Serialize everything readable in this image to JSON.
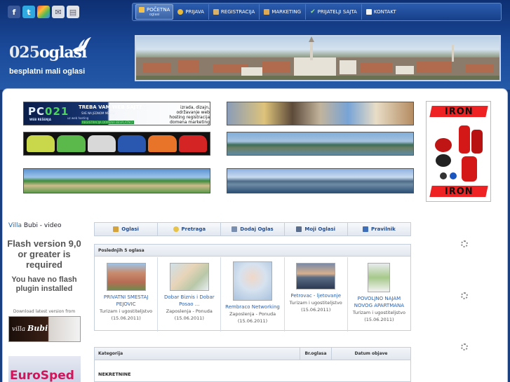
{
  "social": [
    {
      "name": "facebook-icon",
      "glyph": "f"
    },
    {
      "name": "twitter-icon",
      "glyph": "t"
    },
    {
      "name": "delicious-icon",
      "glyph": ""
    },
    {
      "name": "mail-icon",
      "glyph": "✉"
    },
    {
      "name": "print-icon",
      "glyph": "▤"
    }
  ],
  "nav": {
    "items": [
      {
        "label": "POČETNA",
        "sub": "oglasi",
        "icon": "home-icon"
      },
      {
        "label": "PRIJAVA",
        "icon": "key-icon"
      },
      {
        "label": "REGISTRACIJA",
        "icon": "folder-icon"
      },
      {
        "label": "MARKETING",
        "icon": "briefcase-icon"
      },
      {
        "label": "PRIJATELJI SAJTA",
        "icon": "check-icon"
      },
      {
        "label": "KONTAKT",
        "icon": "envelope-icon"
      }
    ]
  },
  "logo": {
    "number": "025",
    "name": "oglasi",
    "tagline": "besplatni mali oglasi"
  },
  "banner_pc021": {
    "brand_pre": "PC",
    "brand_num": "021",
    "sub": "WEB REŠENJA",
    "headline": "TREBA VAM WEB SAJT?",
    "line2": "SVE NA JEDNOM MESTU",
    "line3": "uz web hosting",
    "line4": "REGISTRACIJA DOMENA BESPLATNO!",
    "right": "izrada, dizajn, održavanje web hosting registracija domena marketing"
  },
  "iron": {
    "word": "IRON"
  },
  "sidebar": {
    "villa_a": "Villa",
    "villa_b": "Bubi - video",
    "flash_msg": "Flash version 9,0 or greater is required",
    "flash_missing": "You have no flash plugin installed",
    "download": "Download latest version from",
    "villa_banner_a": "villa",
    "villa_banner_b": "Bubi",
    "euro": "EuroSped"
  },
  "tabs": [
    {
      "label": "Oglasi",
      "icon": "home-icon"
    },
    {
      "label": "Pretraga",
      "icon": "search-icon"
    },
    {
      "label": "Dodaj Oglas",
      "icon": "add-listing-icon"
    },
    {
      "label": "Moji Oglasi",
      "icon": "my-listings-icon"
    },
    {
      "label": "Pravilnik",
      "icon": "book-icon"
    }
  ],
  "latest": {
    "header": "Poslednjih 5 oglasa",
    "items": [
      {
        "title": "PRIVATNI SMESTAJ PEJOVIC",
        "category": "Turizam i ugostiteljstvo",
        "date": "(15.06.2011)"
      },
      {
        "title": "Dobar Biznis i Dobar Posao ...",
        "category": "Zaposlenja - Ponuda",
        "date": "(15.06.2011)"
      },
      {
        "title": "Rembraco Networking",
        "category": "Zaposlenja - Ponuda",
        "date": "(15.06.2011)"
      },
      {
        "title": "Petrovac - ljetovanje",
        "category": "Turizam i ugostiteljstvo",
        "date": "(15.06.2011)"
      },
      {
        "title": "POVOLJNO NAJAM NOVOG APARTMANA",
        "category": "Turizam i ugostiteljstvo",
        "date": "(15.06.2011)"
      }
    ]
  },
  "categories": {
    "col_category": "Kategorija",
    "col_count": "Br.oglasa",
    "col_date": "Datum objave",
    "first_section": "NEKRETNINE"
  }
}
